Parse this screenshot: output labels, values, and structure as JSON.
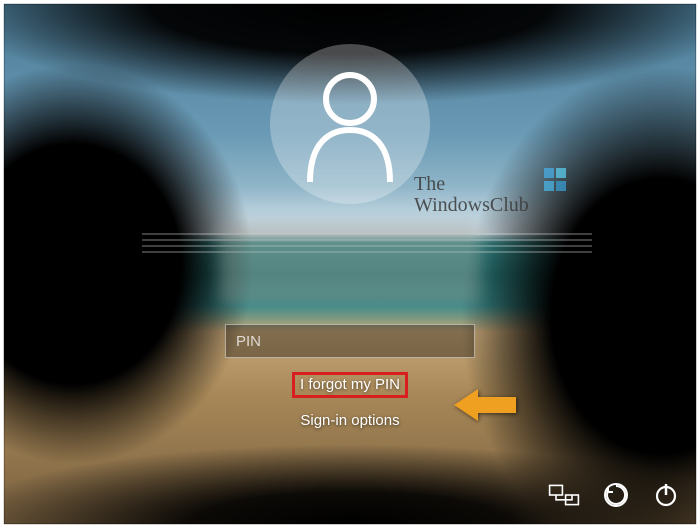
{
  "login": {
    "pin_placeholder": "PIN",
    "forgot_label": "I forgot my PIN",
    "signin_options_label": "Sign-in options"
  },
  "watermark": {
    "line1": "The",
    "line2": "WindowsClub"
  },
  "colors": {
    "highlight_border": "#d81e1e",
    "arrow": "#f0a020"
  }
}
